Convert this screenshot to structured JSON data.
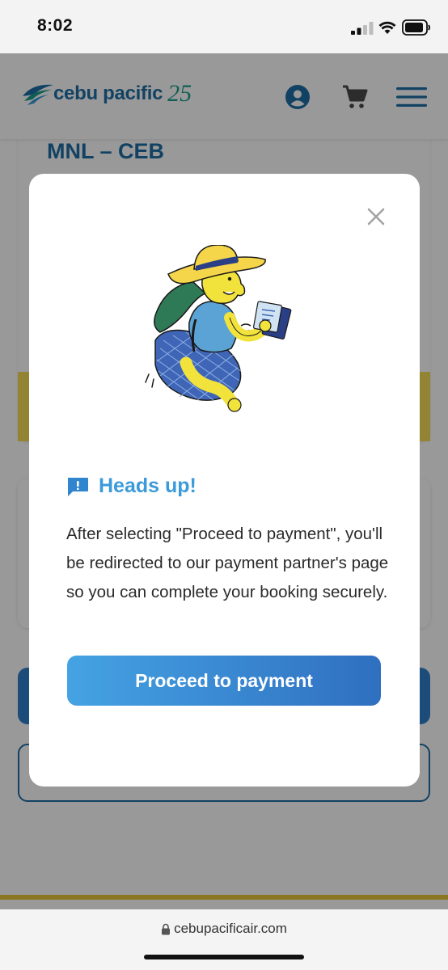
{
  "status_bar": {
    "time": "8:02"
  },
  "header": {
    "logo_text": "cebu pacific",
    "logo_badge": "25",
    "icons": [
      "account-icon",
      "cart-icon",
      "menu-icon"
    ]
  },
  "route": "MNL – CEB",
  "modal": {
    "title": "Heads up!",
    "body": "After selecting \"Proceed to payment\", you'll be redirected to our payment partner's page so you can complete your booking securely.",
    "button": "Proceed to payment",
    "close_icon": "close-icon",
    "title_icon": "alert-message-icon"
  },
  "browser": {
    "url": "cebupacificair.com"
  },
  "colors": {
    "brand_blue": "#1f6fa5",
    "accent_blue": "#3b9ad9",
    "button_gradient_start": "#45a3e3",
    "button_gradient_end": "#2f6fc0",
    "accent_yellow": "#f5dd55"
  }
}
